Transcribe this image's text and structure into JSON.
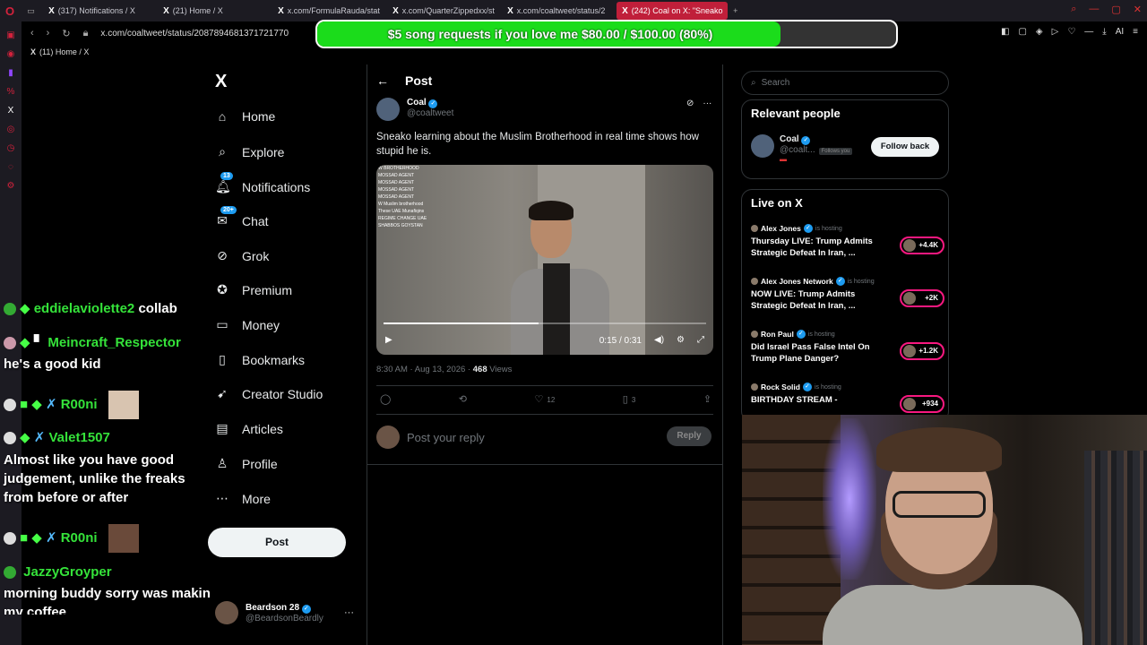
{
  "browser": {
    "tabs": [
      {
        "label": "(317) Notifications / X"
      },
      {
        "label": "(21) Home / X"
      },
      {
        "label": "x.com/FormulaRauda/stat"
      },
      {
        "label": "x.com/QuarterZippedxx/st"
      },
      {
        "label": "x.com/coaltweet/status/2"
      },
      {
        "label": "(242) Coal on X: \"Sneako"
      }
    ],
    "url": "x.com/coaltweet/status/2087894681371721770",
    "bookmark": "(11) Home / X"
  },
  "donation": {
    "text": "$5 song requests if you love me $80.00 / $100.00 (80%)",
    "progress": 0.8,
    "color": "#1bdc1b"
  },
  "xnav": {
    "logo": "X",
    "items": [
      {
        "label": "Home",
        "icon": "home-icon"
      },
      {
        "label": "Explore",
        "icon": "search-icon"
      },
      {
        "label": "Notifications",
        "icon": "bell-icon",
        "badge": "13"
      },
      {
        "label": "Chat",
        "icon": "chat-icon",
        "badge": "20+"
      },
      {
        "label": "Grok",
        "icon": "grok-icon"
      },
      {
        "label": "Premium",
        "icon": "premium-icon"
      },
      {
        "label": "Money",
        "icon": "money-icon"
      },
      {
        "label": "Bookmarks",
        "icon": "bookmark-icon"
      },
      {
        "label": "Creator Studio",
        "icon": "rocket-icon"
      },
      {
        "label": "Articles",
        "icon": "article-icon"
      },
      {
        "label": "Profile",
        "icon": "person-icon"
      },
      {
        "label": "More",
        "icon": "more-icon"
      }
    ],
    "post_label": "Post",
    "account": {
      "name": "Beardson 28",
      "handle": "@BeardsonBeardly"
    }
  },
  "chat": {
    "messages": [
      {
        "user": "eddielaviolette2",
        "text": "collab"
      },
      {
        "user": "Meincraft_Respector",
        "text": "he's a good kid"
      },
      {
        "user": "R00ni",
        "text": ""
      },
      {
        "user": "Valet1507",
        "text": "Almost like you have good judgement, unlike the freaks from before or after"
      },
      {
        "user": "R00ni",
        "text": ""
      },
      {
        "user": "JazzyGroyper",
        "text": "morning buddy sorry was makin my coffee"
      }
    ]
  },
  "post": {
    "header": "Post",
    "author_name": "Coal",
    "author_handle": "@coaltweet",
    "text": "Sneako learning about the Muslim Brotherhood in real time shows how stupid he is.",
    "video_overlay": [
      "W BROTHERHOOD",
      "MOSSAD AGENT",
      "MOSSAD AGENT",
      "MOSSAD AGENT",
      "MOSSAD AGENT",
      "W Muslim brotherhood",
      "These UAE Munafiqins",
      "REGIME CHANGE UAE",
      "SHABBOS GOYSTAN"
    ],
    "video_time": "0:15 / 0:31",
    "video_progress": 0.48,
    "timestamp": "8:30 AM · Aug 13, 2026 · ",
    "views": "468",
    "views_label": " Views",
    "likes": "12",
    "bookmarks": "3",
    "reply_placeholder": "Post your reply",
    "reply_button": "Reply"
  },
  "right": {
    "search_placeholder": "Search",
    "relevant_title": "Relevant people",
    "relevant": {
      "name": "Coal",
      "handle": "@coalt...",
      "follows_you": "Follows you",
      "button": "Follow back"
    },
    "live_title": "Live on X",
    "live": [
      {
        "host": "Alex Jones",
        "status": "is hosting",
        "title": "Thursday LIVE: Trump Admits Strategic Defeat In Iran, ...",
        "count": "+4.4K"
      },
      {
        "host": "Alex Jones Network",
        "status": "is hosting",
        "title": "NOW LIVE: Trump Admits Strategic Defeat In Iran, ...",
        "count": "+2K"
      },
      {
        "host": "Ron Paul",
        "status": "is hosting",
        "title": "Did Israel Pass False Intel On Trump Plane Danger?",
        "count": "+1.2K"
      },
      {
        "host": "Rock Solid",
        "status": "is hosting",
        "title": "BIRTHDAY STREAM -",
        "count": "+934"
      }
    ]
  }
}
